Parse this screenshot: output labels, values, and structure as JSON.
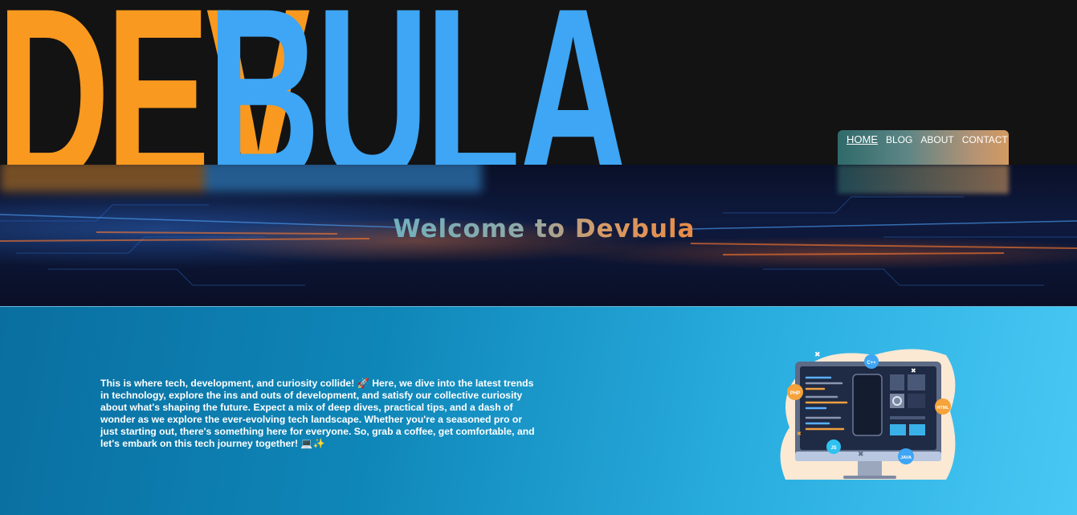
{
  "header": {
    "logo_part1": "DEV",
    "logo_part2": "BULA",
    "logo_colors": {
      "dev": "#f9991f",
      "bula": "#3ea6f4"
    }
  },
  "nav": {
    "items": [
      {
        "label": "HOME",
        "active": true
      },
      {
        "label": "BLOG",
        "active": false
      },
      {
        "label": "ABOUT",
        "active": false
      },
      {
        "label": "CONTACT",
        "active": false
      }
    ]
  },
  "hero": {
    "title": "Welcome to Devbula"
  },
  "intro": {
    "text": "This is where tech, development, and curiosity collide! 🚀 Here, we dive into the latest trends in technology, explore the ins and outs of development, and satisfy our collective curiosity about what's shaping the future. Expect a mix of deep dives, practical tips, and a dash of wonder as we explore the ever-evolving tech landscape. Whether you're a seasoned pro or just starting out, there's something here for everyone. So, grab a coffee, get comfortable, and let's embark on this tech journey together! 💻✨"
  },
  "illustration": {
    "badges": {
      "cpp": "C++",
      "php": "PHP",
      "html": "HTML",
      "js": "JS",
      "java": "JAVA"
    }
  }
}
